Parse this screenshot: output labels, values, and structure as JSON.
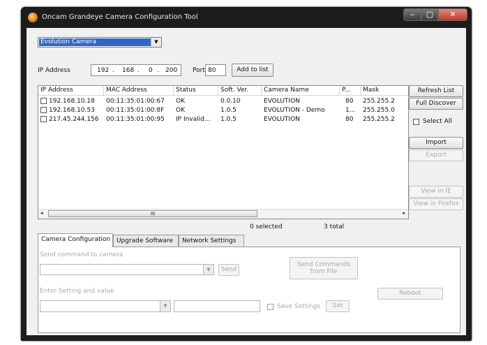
{
  "window": {
    "title": "Oncam Grandeye Camera Configuration Tool"
  },
  "camera_type": {
    "selected": "Evolution Camera"
  },
  "ip": {
    "label": "IP Address",
    "octets": [
      "192",
      "168",
      "0",
      "200"
    ],
    "port_label": "Port",
    "port_value": "80",
    "add_button": "Add to list"
  },
  "table": {
    "columns": [
      "IP Address",
      "MAC Address",
      "Status",
      "Soft. Ver.",
      "Camera Name",
      "P...",
      "Mask"
    ],
    "rows": [
      {
        "ip": "192.168.10.18",
        "mac": "00:11:35:01:00:67",
        "status": "OK",
        "ver": "0.0.10",
        "name": "EVOLUTION",
        "port": "80",
        "mask": "255.255.2"
      },
      {
        "ip": "192.168.10.53",
        "mac": "00:11:35:01:00:8F",
        "status": "OK",
        "ver": "1.0.5",
        "name": "EVOLUTION - Demo",
        "port": "1...",
        "mask": "255.255.0"
      },
      {
        "ip": "217.45.244.156",
        "mac": "00:11:35:01:00:95",
        "status": "IP Invalid...",
        "ver": "1.0.5",
        "name": "EVOLUTION",
        "port": "80",
        "mask": "255.255.2"
      }
    ],
    "scroll_grip": "III"
  },
  "side": {
    "refresh": "Refresh List",
    "full_discover": "Full Discover",
    "select_all": "Select All",
    "import": "Import",
    "export": "Export",
    "view_ie": "View in IE",
    "view_firefox": "View in Firefox"
  },
  "status": {
    "selected": "0 selected",
    "total": "3 total"
  },
  "tabs": [
    "Camera Configuration",
    "Upgrade Software",
    "Network Settings"
  ],
  "config": {
    "send_label": "Send command to camera",
    "send_button": "Send",
    "send_file_button_line1": "Send Commands",
    "send_file_button_line2": "from File",
    "setting_label": "Enter Setting and value",
    "reboot_button": "Reboot",
    "save_settings": "Save Settings",
    "set_button": "Set"
  }
}
